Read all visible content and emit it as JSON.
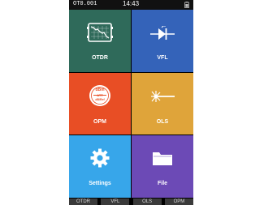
{
  "status": {
    "file_name": "OT0.001",
    "time": "14:43"
  },
  "tiles": {
    "otdr": {
      "label": "OTDR",
      "color": "#2f6a5a",
      "icon": "otdr-trace-icon"
    },
    "vfl": {
      "label": "VFL",
      "color": "#3463b9",
      "icon": "laser-diode-icon"
    },
    "opm": {
      "label": "OPM",
      "color": "#e84e25",
      "icon": "power-meter-icon",
      "icon_text": [
        "dBm",
        "ATT",
        "dB/Ref"
      ]
    },
    "ols": {
      "label": "OLS",
      "color": "#dfa43a",
      "icon": "light-source-icon"
    },
    "settings": {
      "label": "Settings",
      "color": "#37a6ea",
      "icon": "gear-icon"
    },
    "file": {
      "label": "File",
      "color": "#6c4ab6",
      "icon": "folder-icon"
    }
  },
  "bottom_tabs": [
    "OTDR",
    "VFL",
    "OLS",
    "OPM"
  ]
}
